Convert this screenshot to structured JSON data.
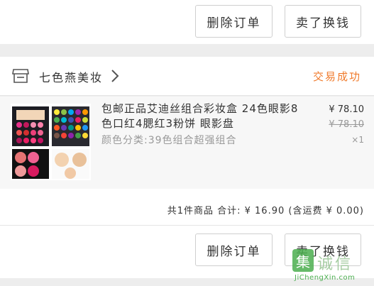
{
  "top_actions": {
    "delete_label": "删除订单",
    "sell_label": "卖了换钱"
  },
  "shop": {
    "icon": "store-icon",
    "name": "七色燕美妆",
    "chevron_icon": "chevron-right-icon",
    "status": "交易成功"
  },
  "product": {
    "title": "包邮正品艾迪丝组合彩妆盒 24色眼影8色口红4腮红3粉饼 眼影盘",
    "spec": "颜色分类:39色组合超强组合",
    "price": "¥ 78.10",
    "original_price": "¥ 78.10",
    "quantity": "×1"
  },
  "summary": {
    "text": "共1件商品  合计: ¥ 16.90 (含运费 ¥ 0.00)"
  },
  "bottom_actions": {
    "delete_label": "删除订单",
    "sell_label": "卖了换钱"
  },
  "watermark": {
    "glyph": "集",
    "title": "诚信",
    "url": "JiChengXin.com"
  }
}
